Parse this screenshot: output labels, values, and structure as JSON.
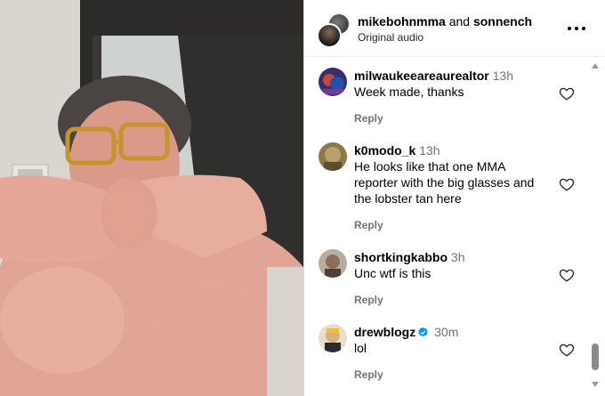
{
  "header": {
    "user1": "mikebohnmma",
    "joiner": "and",
    "user2": "sonnench",
    "subtitle": "Original audio"
  },
  "comments": [
    {
      "username": "milwaukeeareaurealtor",
      "time": "13h",
      "text": "Week made, thanks",
      "reply": "Reply",
      "verified": false
    },
    {
      "username": "k0modo_k",
      "time": "13h",
      "text": "He looks like that one MMA reporter with the big glasses and the lobster tan here",
      "reply": "Reply",
      "verified": false
    },
    {
      "username": "shortkingkabbo",
      "time": "3h",
      "text": "Unc wtf is this",
      "reply": "Reply",
      "verified": false
    },
    {
      "username": "drewblogz",
      "time": "30m",
      "text": "lol",
      "reply": "Reply",
      "verified": true
    }
  ],
  "icons": {
    "more": "more-horizontal-icon",
    "heart": "heart-outline-icon",
    "verified": "verified-badge-icon"
  },
  "colors": {
    "verified": "#0095f6",
    "secondary_text": "#737373"
  }
}
